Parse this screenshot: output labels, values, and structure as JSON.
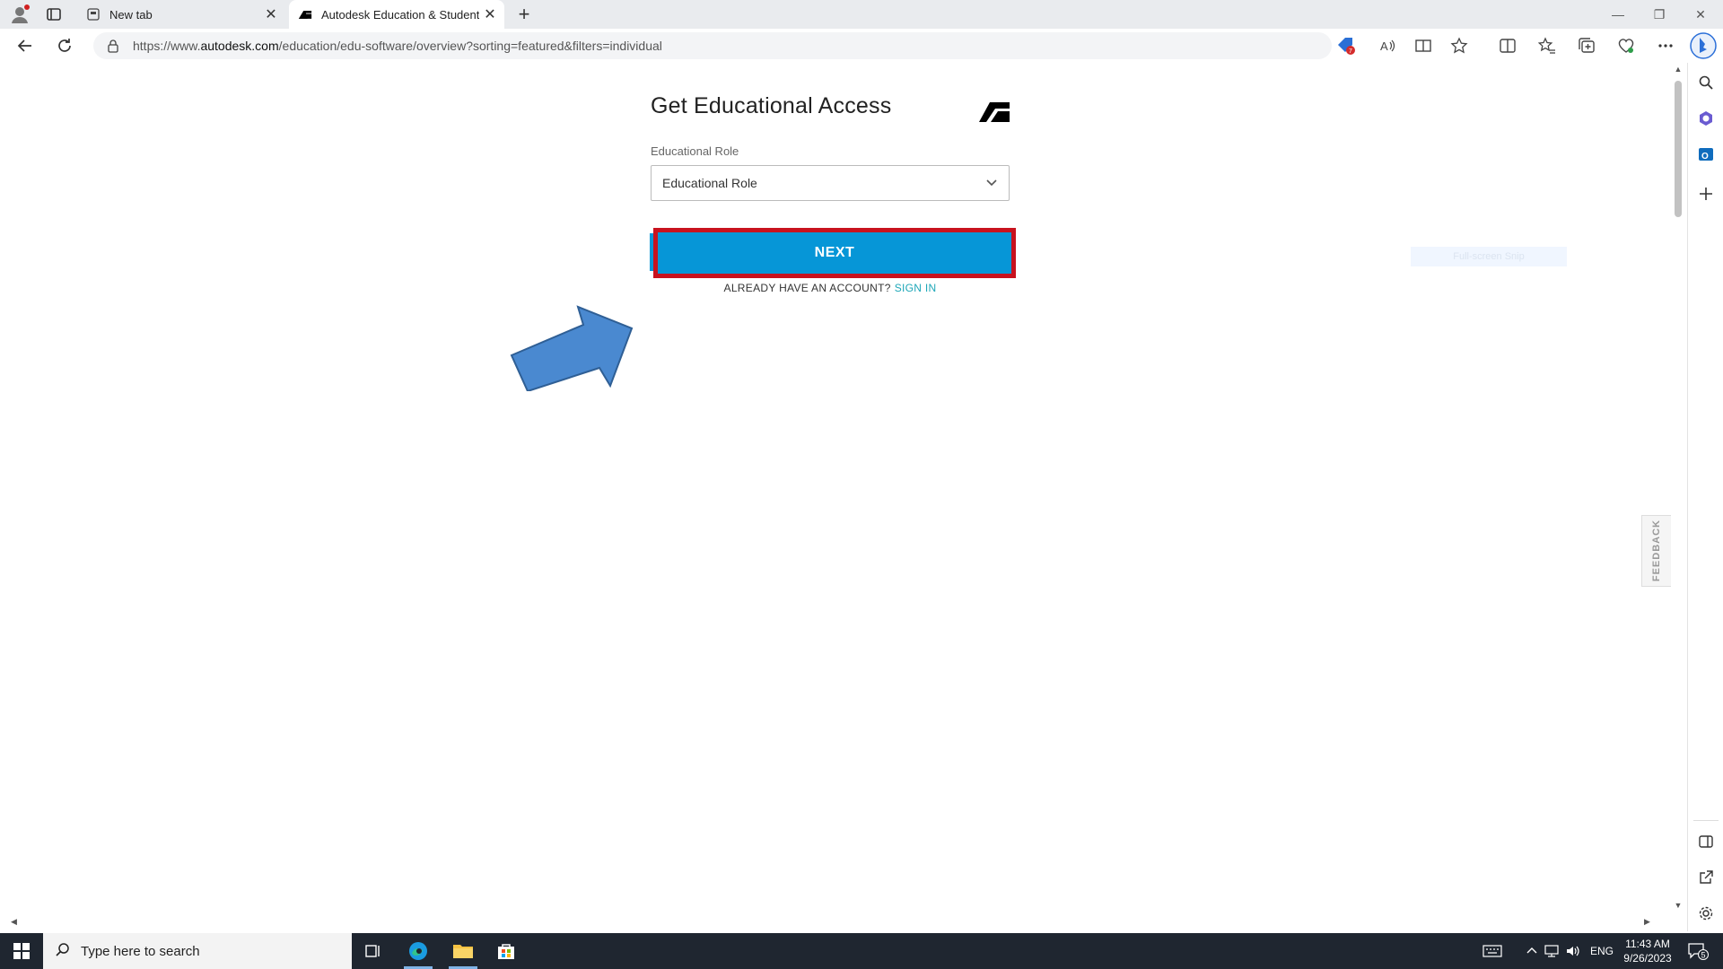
{
  "browser": {
    "tabs": [
      {
        "title": "New tab",
        "active": false
      },
      {
        "title": "Autodesk Education & Student A",
        "active": true
      }
    ],
    "url_prefix": "https://www.",
    "url_domain": "autodesk.com",
    "url_path": "/education/edu-software/overview?sorting=featured&filters=individual",
    "shopping_badge": "7"
  },
  "page": {
    "title": "Get Educational Access",
    "role_label": "Educational Role",
    "role_select_value": "Educational Role",
    "next_label": "NEXT",
    "already_text": "ALREADY HAVE AN ACCOUNT?",
    "signin_label": "SIGN IN",
    "snip_hint": "Full-screen Snip",
    "feedback_label": "FEEDBACK"
  },
  "taskbar": {
    "search_placeholder": "Type here to search",
    "language": "ENG",
    "time": "11:43 AM",
    "date": "9/26/2023",
    "notification_count": "5"
  },
  "colors": {
    "next_button": "#0696d7",
    "highlight_border": "#c8121e",
    "arrow_fill": "#4a89d0",
    "signin_link": "#1ea7b8"
  }
}
